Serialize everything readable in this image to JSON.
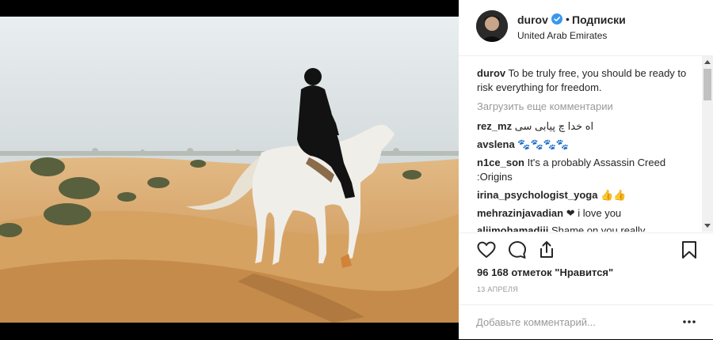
{
  "post": {
    "author": {
      "username": "durov",
      "separator": "•",
      "follow_label": "Подписки",
      "location": "United Arab Emirates",
      "verified": true
    },
    "caption": {
      "username": "durov",
      "text": "To be truly free, you should be ready to risk everything for freedom."
    },
    "load_more_label": "Загрузить еще комментарии",
    "comments": [
      {
        "username": "rez_mz",
        "text": "اه خدا چ پیابی سی"
      },
      {
        "username": "avslena",
        "text": "🐾🐾🐾🐾"
      },
      {
        "username": "n1ce_son",
        "text": "It's a probably Assassin Creed :Origins"
      },
      {
        "username": "irina_psychologist_yoga",
        "text": "👍👍"
      },
      {
        "username": "mehrazinjavadian",
        "text": "❤ i love you"
      },
      {
        "username": "alijmohamadiji",
        "text": "Shame on you really"
      }
    ],
    "likes_text": "96 168 отметок \"Нравится\"",
    "date_text": "13 АПРЕЛЯ",
    "comment_placeholder": "Добавьте комментарий...",
    "icons": {
      "like": "heart-icon",
      "comment": "comment-bubble-icon",
      "share": "share-icon",
      "save": "bookmark-icon",
      "more": "more-options-icon",
      "verified": "verified-badge-icon"
    },
    "colors": {
      "verified": "#3897f0",
      "heart_emoji": "#ed4956",
      "text": "#262626",
      "muted": "#999999",
      "sand": "#d9a867",
      "sky": "#dfe6e8"
    }
  }
}
